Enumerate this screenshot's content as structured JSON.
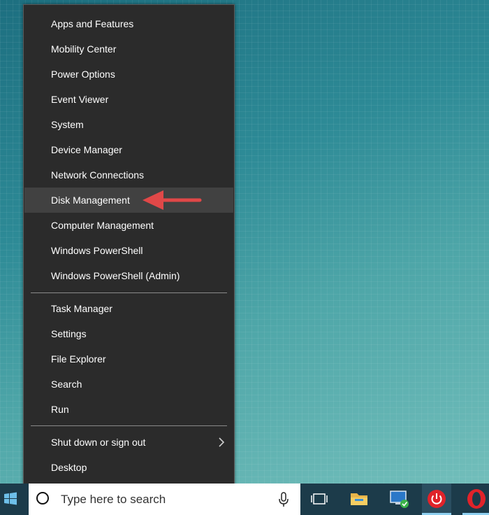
{
  "menu": {
    "group1": [
      "Apps and Features",
      "Mobility Center",
      "Power Options",
      "Event Viewer",
      "System",
      "Device Manager",
      "Network Connections",
      "Disk Management",
      "Computer Management",
      "Windows PowerShell",
      "Windows PowerShell (Admin)"
    ],
    "group2": [
      "Task Manager",
      "Settings",
      "File Explorer",
      "Search",
      "Run"
    ],
    "group3": [
      "Shut down or sign out",
      "Desktop"
    ],
    "highlighted_item": "Disk Management"
  },
  "annotation": {
    "arrow_color": "#e04848",
    "arrow_target": "Disk Management"
  },
  "taskbar": {
    "search_placeholder": "Type here to search",
    "icons": [
      "windows-start-icon",
      "search-icon",
      "microphone-icon",
      "task-view-icon",
      "file-explorer-icon",
      "network-computer-icon",
      "power-app-icon",
      "opera-icon"
    ]
  }
}
